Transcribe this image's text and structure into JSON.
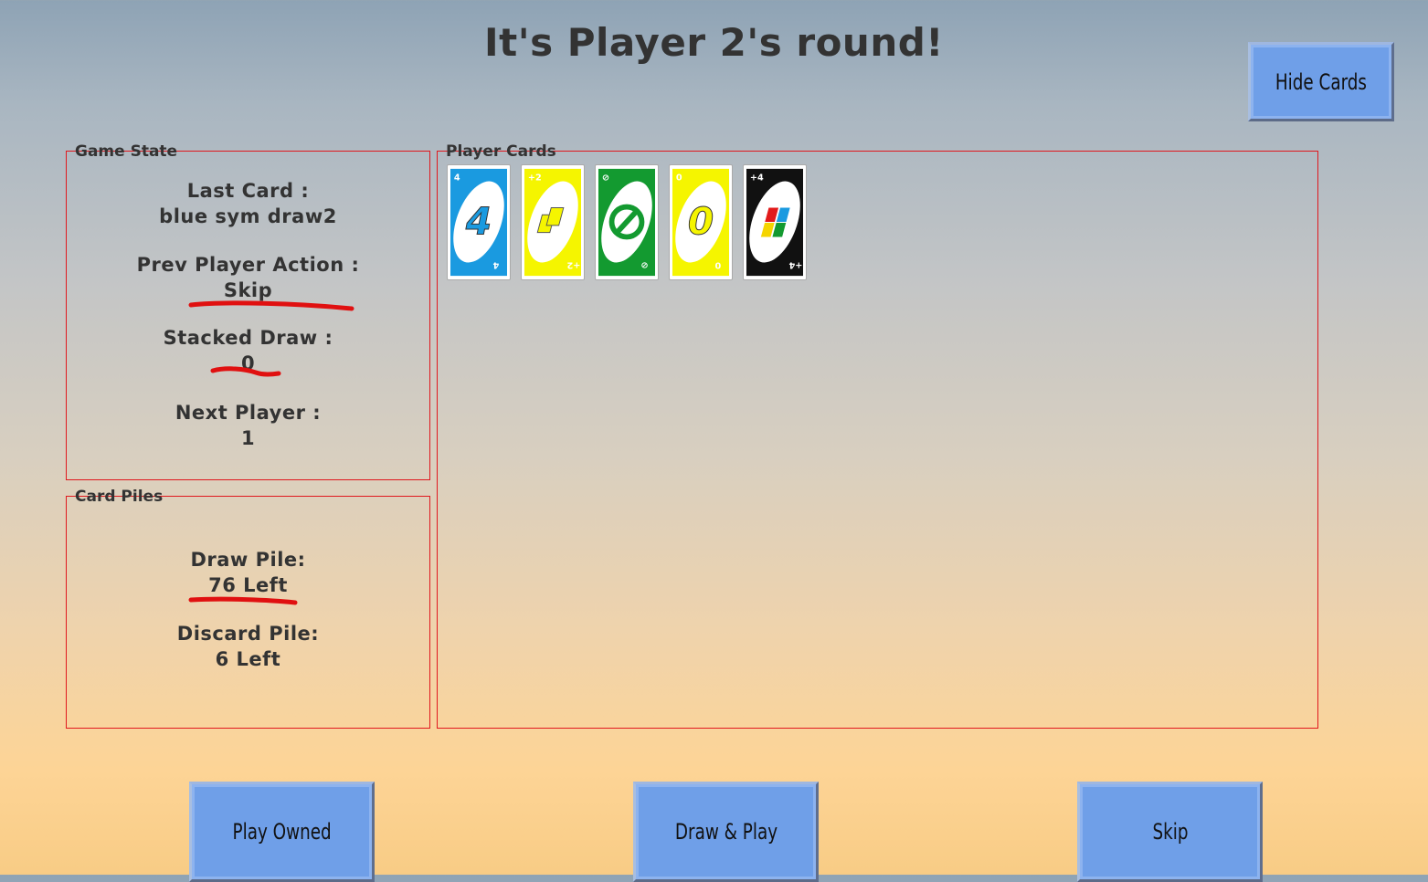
{
  "title": "It's Player 2's round!",
  "hide_cards_label": "Hide Cards",
  "game_state": {
    "title": "Game State",
    "last_card_label": "Last Card :",
    "last_card_value": "blue sym draw2",
    "prev_action_label": "Prev Player Action :",
    "prev_action_value": "Skip",
    "stacked_draw_label": "Stacked Draw :",
    "stacked_draw_value": "0",
    "next_player_label": "Next Player :",
    "next_player_value": "1"
  },
  "card_piles": {
    "title": "Card Piles",
    "draw_pile_label": "Draw Pile:",
    "draw_pile_value": "76 Left",
    "discard_pile_label": "Discard Pile:",
    "discard_pile_value": "6 Left"
  },
  "player_cards": {
    "title": "Player Cards",
    "cards": [
      {
        "color": "#1a9ae0",
        "center": "4",
        "corner": "4",
        "name": "blue-4-card"
      },
      {
        "color": "#f5f500",
        "center": "draw2",
        "corner": "+2",
        "name": "yellow-draw2-card"
      },
      {
        "color": "#139a30",
        "center": "skip",
        "corner": "⊘",
        "name": "green-skip-card"
      },
      {
        "color": "#f5f500",
        "center": "0",
        "corner": "0",
        "name": "yellow-0-card"
      },
      {
        "color": "#111111",
        "center": "wild4",
        "corner": "+4",
        "name": "wild-draw4-card"
      }
    ]
  },
  "actions": {
    "play_owned_label": "Play Owned",
    "draw_play_label": "Draw & Play",
    "skip_label": "Skip"
  },
  "colors": {
    "panel_border": "#e0181e",
    "button": "#6f9fe8",
    "annotation": "#e01010"
  }
}
